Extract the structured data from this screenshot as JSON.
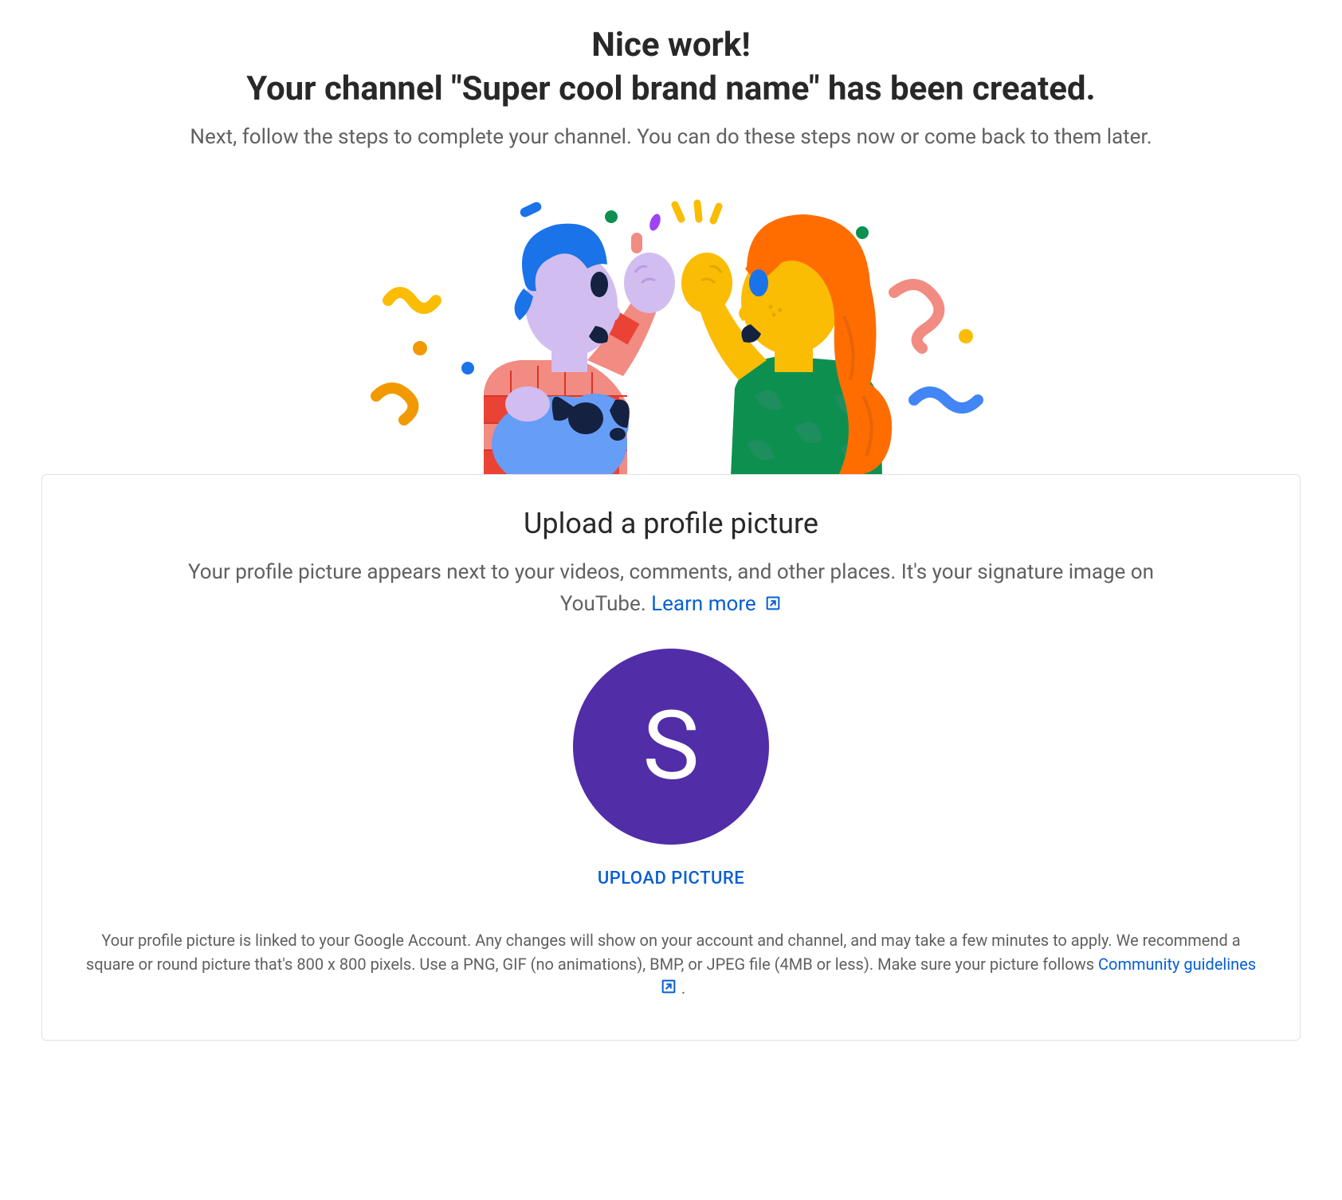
{
  "header": {
    "title_line1": "Nice work!",
    "title_line2": "Your channel \"Super cool brand name\" has been created.",
    "subtitle": "Next, follow the steps to complete your channel. You can do these steps now or come back to them later."
  },
  "card": {
    "title": "Upload a profile picture",
    "description": "Your profile picture appears next to your videos, comments, and other places. It's your signature image on YouTube. ",
    "learn_more_label": "Learn more",
    "avatar_letter": "S",
    "upload_button_label": "UPLOAD PICTURE",
    "footer_text_1": "Your profile picture is linked to your Google Account. Any changes will show on your account and channel, and may take a few minutes to apply. We recommend a square or round picture that's 800 x 800 pixels. Use a PNG, GIF (no animations), BMP, or JPEG file (4MB or less). Make sure your picture follows ",
    "community_guidelines_label": "Community guidelines",
    "footer_text_2": " ."
  },
  "colors": {
    "link": "#065fd4",
    "avatar_bg": "#512da8",
    "text_primary": "#282828",
    "text_secondary": "#606060"
  }
}
